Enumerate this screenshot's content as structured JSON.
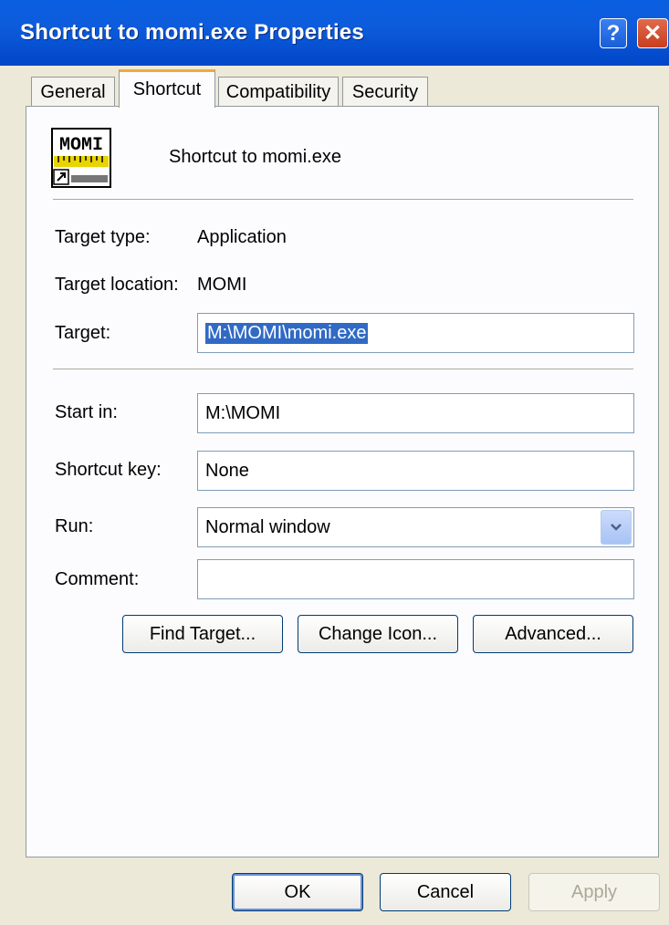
{
  "window": {
    "title": "Shortcut to momi.exe Properties",
    "help_glyph": "?",
    "close_glyph": "✕"
  },
  "tabs": [
    {
      "label": "General"
    },
    {
      "label": "Shortcut"
    },
    {
      "label": "Compatibility"
    },
    {
      "label": "Security"
    }
  ],
  "header": {
    "shortcut_name": "Shortcut to momi.exe",
    "icon_text": "MOMI"
  },
  "fields": {
    "target_type_label": "Target type:",
    "target_type_value": "Application",
    "target_location_label": "Target location:",
    "target_location_value": "MOMI",
    "target_label": "Target:",
    "target_value": "M:\\MOMI\\momi.exe",
    "start_in_label": "Start in:",
    "start_in_value": "M:\\MOMI",
    "shortcut_key_label": "Shortcut key:",
    "shortcut_key_value": "None",
    "run_label": "Run:",
    "run_value": "Normal window",
    "comment_label": "Comment:",
    "comment_value": ""
  },
  "buttons": {
    "find_target": "Find Target...",
    "change_icon": "Change Icon...",
    "advanced": "Advanced...",
    "ok": "OK",
    "cancel": "Cancel",
    "apply": "Apply"
  },
  "colors": {
    "titlebar": "#0A5FE0",
    "tab_highlight": "#F2A93B",
    "selection": "#316AC5"
  }
}
